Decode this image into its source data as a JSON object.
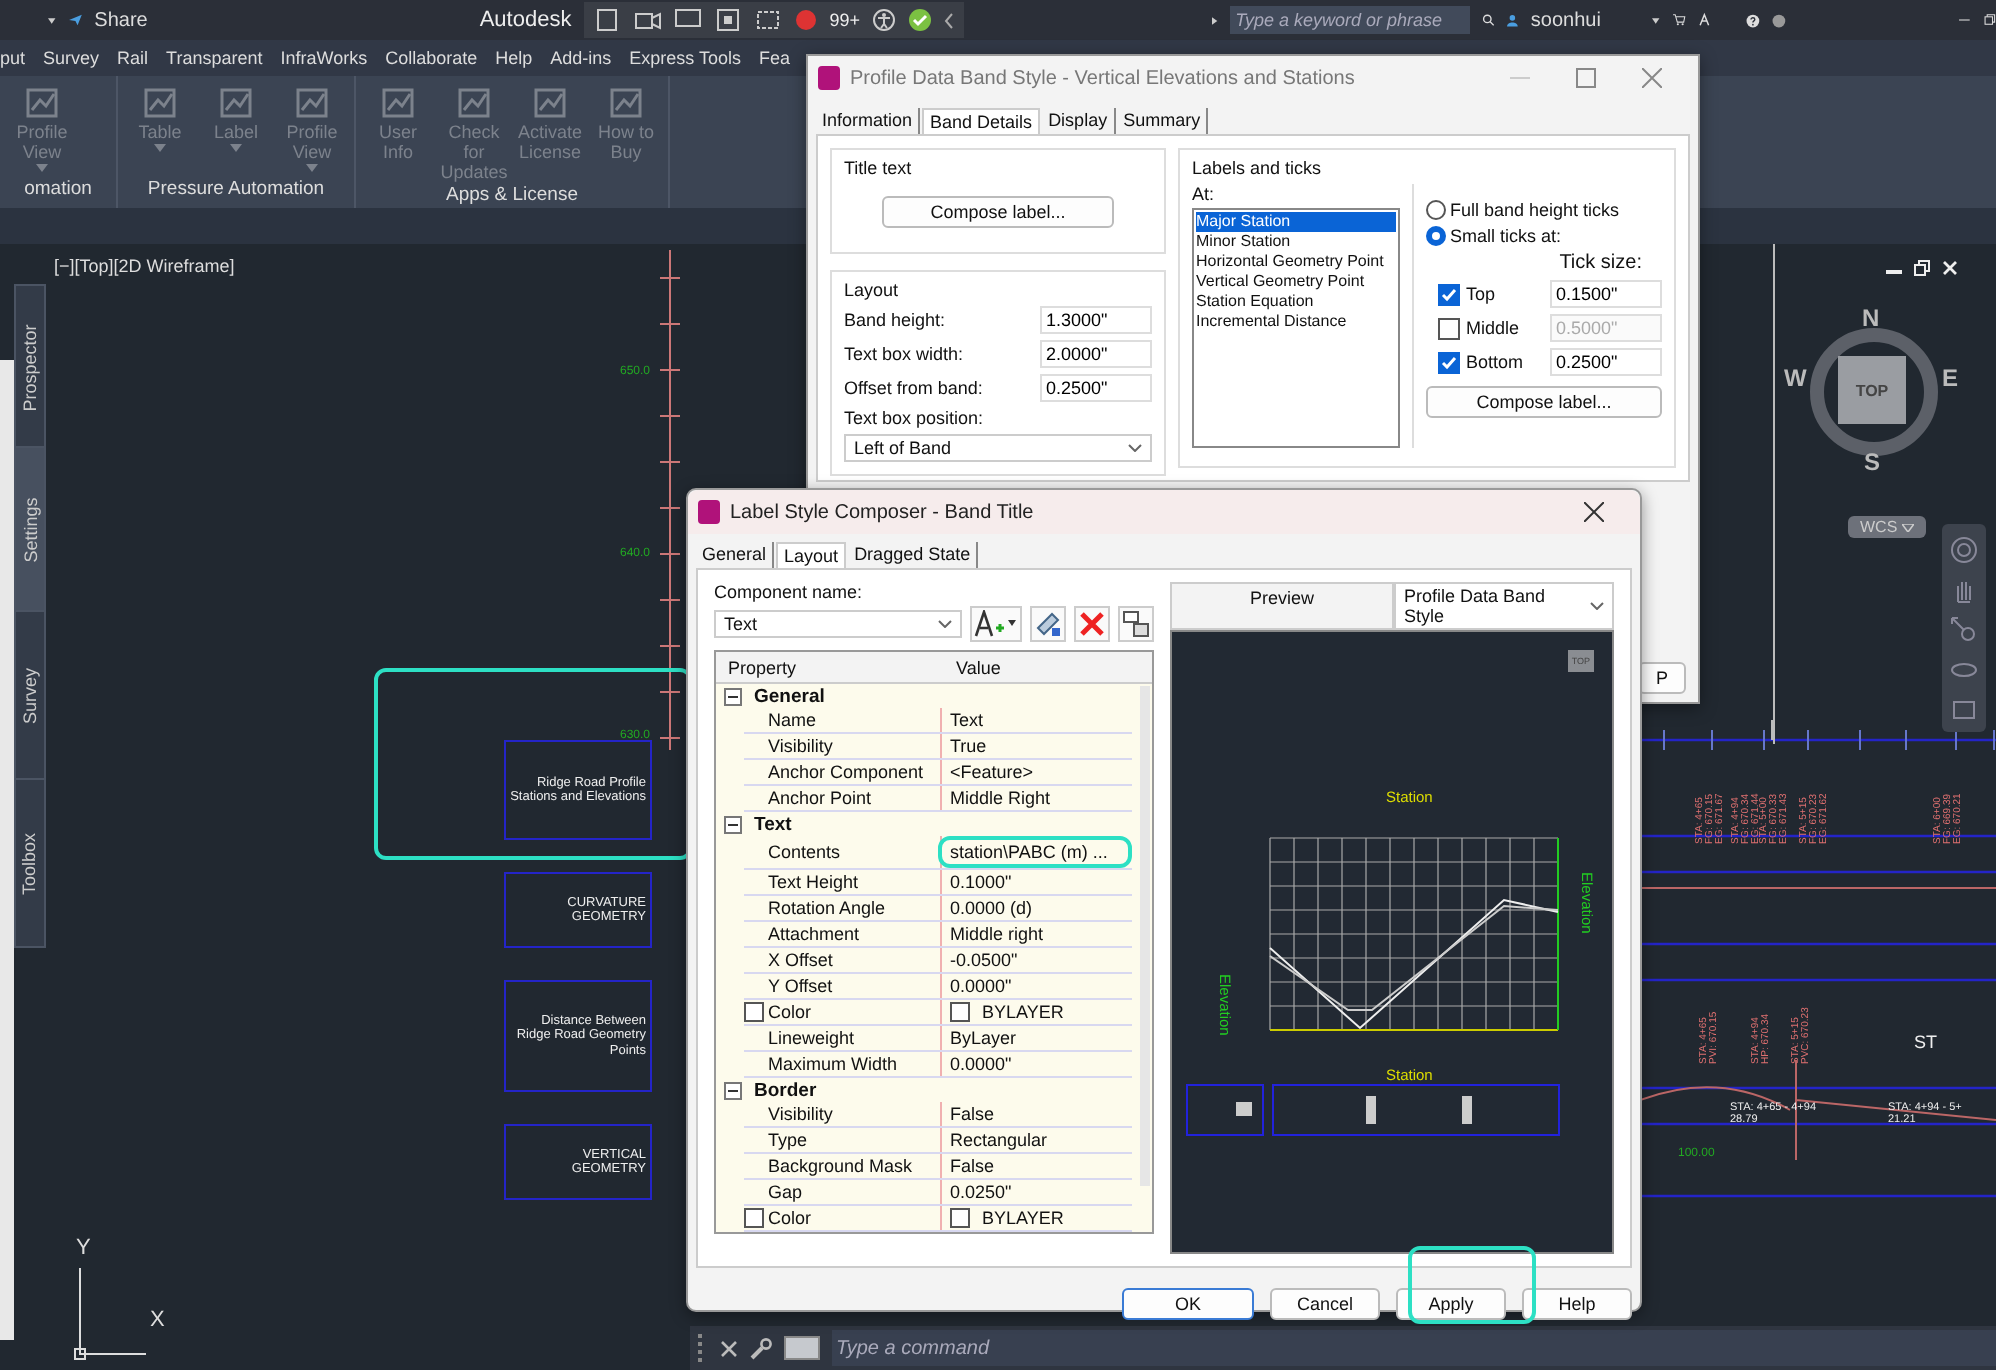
{
  "title_bar": {
    "share": "Share",
    "app_title": "Autodesk",
    "notification_badge": "99+",
    "search": {
      "placeholder": "Type a keyword or phrase"
    },
    "user": "soonhui"
  },
  "ribbon": {
    "tabs": [
      "put",
      "Survey",
      "Rail",
      "Transparent",
      "InfraWorks",
      "Collaborate",
      "Help",
      "Add-ins",
      "Express Tools",
      "Fea"
    ],
    "panels": [
      {
        "title": "omation",
        "buttons": [
          {
            "label": "Profile View",
            "dropdown": true
          }
        ]
      },
      {
        "title": "Pressure Automation",
        "buttons": [
          {
            "label": "Table",
            "dropdown": true
          },
          {
            "label": "Label",
            "dropdown": true
          },
          {
            "label": "Profile View",
            "dropdown": true
          }
        ]
      },
      {
        "title": "Apps & License",
        "buttons": [
          {
            "label": "User Info",
            "dropdown": false
          },
          {
            "label": "Check for Updates",
            "dropdown": false
          },
          {
            "label": "Activate License",
            "dropdown": false
          },
          {
            "label": "How to Buy",
            "dropdown": false
          }
        ]
      }
    ]
  },
  "palette": {
    "tabs": [
      {
        "label": "Prospector",
        "selected": false
      },
      {
        "label": "Settings",
        "selected": true
      },
      {
        "label": "Survey",
        "selected": false
      },
      {
        "label": "Toolbox",
        "selected": false
      }
    ]
  },
  "viewport": {
    "label": "[−][Top][2D Wireframe]",
    "elevations": [
      "650.0",
      "640.0",
      "630.0"
    ],
    "band_titles": [
      "Ridge Road Profile Stations and Elevations",
      "CURVATURE GEOMETRY",
      "Distance Between Ridge Road Geometry Points",
      "VERTICAL GEOMETRY"
    ],
    "station_labels": [
      [
        "STA: 4+65",
        "FG: 670.15",
        "EG: 671.67"
      ],
      [
        "STA: 4+94",
        "FG: 670.34",
        "EG: 671.44"
      ],
      [
        "STA: 5+00",
        "FG: 670.33",
        "EG: 671.43"
      ],
      [
        "STA: 5+15",
        "FG: 670.23",
        "EG: 671.62"
      ],
      [
        "STA: 6+00",
        "FG: 669.39",
        "EG: 670.21"
      ]
    ],
    "geometry_labels": [
      [
        "STA: 4+65",
        "PVI: 670.15"
      ],
      [
        "STA: 4+94",
        "HP: 670.34"
      ],
      [
        "STA: 5+15",
        "PVC: 670.23"
      ]
    ],
    "distance_labels": [
      [
        "STA: 4+65 - 4+94",
        "28.79"
      ],
      [
        "STA: 4+94 - 5+",
        "21.21"
      ]
    ],
    "edge_label": "ST",
    "curve_value": "100.00",
    "viewcube": {
      "north": "N",
      "south": "S",
      "east": "E",
      "west": "W",
      "face": "TOP",
      "ucs": "WCS"
    },
    "ucs_axes": {
      "y": "Y",
      "x": "X"
    },
    "command_line": {
      "placeholder": "Type a command"
    }
  },
  "band_style_dialog": {
    "title": "Profile Data Band Style - Vertical Elevations and Stations",
    "tabs": [
      {
        "label": "Information",
        "selected": false
      },
      {
        "label": "Band Details",
        "selected": true
      },
      {
        "label": "Display",
        "selected": false
      },
      {
        "label": "Summary",
        "selected": false
      }
    ],
    "title_text": {
      "heading": "Title text",
      "button": "Compose label..."
    },
    "layout": {
      "heading": "Layout",
      "fields": [
        {
          "label": "Band height:",
          "value": "1.3000\""
        },
        {
          "label": "Text box width:",
          "value": "2.0000\""
        },
        {
          "label": "Offset from band:",
          "value": "0.2500\""
        }
      ],
      "position_label": "Text box position:",
      "position_value": "Left of Band"
    },
    "labels_ticks": {
      "heading": "Labels and ticks",
      "at_label": "At:",
      "items": [
        {
          "label": "Major Station",
          "selected": true
        },
        {
          "label": "Minor Station",
          "selected": false
        },
        {
          "label": "Horizontal Geometry Point",
          "selected": false
        },
        {
          "label": "Vertical Geometry Point",
          "selected": false
        },
        {
          "label": "Station Equation",
          "selected": false
        },
        {
          "label": "Incremental Distance",
          "selected": false
        }
      ],
      "tick_modes": [
        {
          "label": "Full band height ticks",
          "selected": false
        },
        {
          "label": "Small ticks at:",
          "selected": true
        }
      ],
      "tick_size_label": "Tick size:",
      "ticks": [
        {
          "label": "Top",
          "checked": true,
          "value": "0.1500\""
        },
        {
          "label": "Middle",
          "checked": false,
          "value": "0.5000\""
        },
        {
          "label": "Bottom",
          "checked": true,
          "value": "0.2500\""
        }
      ],
      "button": "Compose label..."
    },
    "hidden_button": "P"
  },
  "composer_dialog": {
    "title": "Label Style Composer - Band Title",
    "tabs": [
      {
        "label": "General",
        "selected": false
      },
      {
        "label": "Layout",
        "selected": true
      },
      {
        "label": "Dragged State",
        "selected": false
      }
    ],
    "component_label": "Component name:",
    "component_value": "Text",
    "columns": [
      "Property",
      "Value"
    ],
    "sections": [
      {
        "title": "General",
        "expanded": true,
        "rows": [
          {
            "kind": "text",
            "property": "Name",
            "value": "Text",
            "highlighted": false
          },
          {
            "kind": "text",
            "property": "Visibility",
            "value": "True",
            "highlighted": false
          },
          {
            "kind": "text",
            "property": "Anchor Component",
            "value": "<Feature>",
            "highlighted": false
          },
          {
            "kind": "text",
            "property": "Anchor Point",
            "value": "Middle Right",
            "highlighted": false
          }
        ]
      },
      {
        "title": "Text",
        "expanded": true,
        "rows": [
          {
            "kind": "text",
            "property": "Contents",
            "value": "station\\PABC (m) ...",
            "highlighted": true
          },
          {
            "kind": "text",
            "property": "Text Height",
            "value": "0.1000\"",
            "highlighted": false
          },
          {
            "kind": "text",
            "property": "Rotation Angle",
            "value": "0.0000 (d)",
            "highlighted": false
          },
          {
            "kind": "text",
            "property": "Attachment",
            "value": "Middle right",
            "highlighted": false
          },
          {
            "kind": "text",
            "property": "X Offset",
            "value": "-0.0500\"",
            "highlighted": false
          },
          {
            "kind": "text",
            "property": "Y Offset",
            "value": "0.0000\"",
            "highlighted": false
          },
          {
            "kind": "color",
            "property": "Color",
            "value": "BYLAYER",
            "highlighted": false
          },
          {
            "kind": "text",
            "property": "Lineweight",
            "value": "ByLayer",
            "highlighted": false
          },
          {
            "kind": "text",
            "property": "Maximum Width",
            "value": "0.0000\"",
            "highlighted": false
          }
        ]
      },
      {
        "title": "Border",
        "expanded": true,
        "rows": [
          {
            "kind": "text",
            "property": "Visibility",
            "value": "False",
            "highlighted": false
          },
          {
            "kind": "text",
            "property": "Type",
            "value": "Rectangular",
            "highlighted": false
          },
          {
            "kind": "text",
            "property": "Background Mask",
            "value": "False",
            "highlighted": false
          },
          {
            "kind": "text",
            "property": "Gap",
            "value": "0.0250\"",
            "highlighted": false
          },
          {
            "kind": "color",
            "property": "Color",
            "value": "BYLAYER",
            "highlighted": false
          }
        ]
      }
    ],
    "preview": {
      "label": "Preview",
      "style": "Profile Data Band Style",
      "face": "TOP",
      "top_title": "Station",
      "bottom_title": "Station",
      "left_title": "Elevation",
      "right_title": "Elevation"
    },
    "buttons": [
      "OK",
      "Cancel",
      "Apply",
      "Help"
    ]
  }
}
